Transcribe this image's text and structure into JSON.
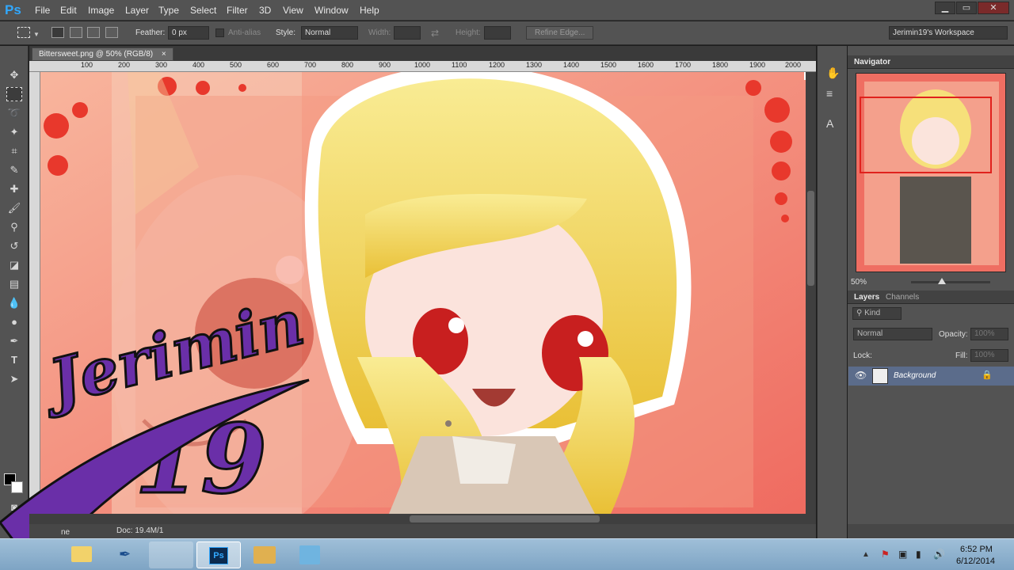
{
  "app": {
    "logo": "Ps"
  },
  "menu": [
    "File",
    "Edit",
    "Image",
    "Layer",
    "Type",
    "Select",
    "Filter",
    "3D",
    "View",
    "Window",
    "Help"
  ],
  "window_controls": [
    "▁",
    "▭",
    "✕"
  ],
  "options": {
    "feather_label": "Feather:",
    "feather_value": "0 px",
    "antialias_label": "Anti-alias",
    "style_label": "Style:",
    "style_value": "Normal",
    "width_label": "Width:",
    "height_label": "Height:",
    "refine_edge": "Refine Edge...",
    "workspace": "Jerimin19's Workspace"
  },
  "document": {
    "tab_title": "Bittersweet.png @ 50% (RGB/8)",
    "tab_close": "×",
    "ruler_ticks": [
      "100",
      "200",
      "300",
      "400",
      "500",
      "600",
      "700",
      "800",
      "900",
      "1000",
      "1100",
      "1200",
      "1300",
      "1400",
      "1500",
      "1600",
      "1700",
      "1800",
      "1900",
      "2000"
    ],
    "status_doc": "Doc: 19.4M/1",
    "status_label": "ne"
  },
  "watermark": {
    "name": "Jerimin",
    "number": "19"
  },
  "navigator": {
    "title": "Navigator",
    "zoom": "50%"
  },
  "layers_panel": {
    "tab_layers": "Layers",
    "tab_channels": "Channels",
    "kind": "Kind",
    "blend_mode": "Normal",
    "opacity_label": "Opacity:",
    "opacity_value": "100%",
    "lock_label": "Lock:",
    "fill_label": "Fill:",
    "fill_value": "100%",
    "layer_name": "Background"
  },
  "taskbar": {
    "time": "6:52 PM",
    "date": "6/12/2014"
  },
  "colors": {
    "canvas_bg": "#f07a6c",
    "hair": "#f3d34a",
    "watermark": "#6a2fa8",
    "selected_layer": "#5b6c8b"
  }
}
